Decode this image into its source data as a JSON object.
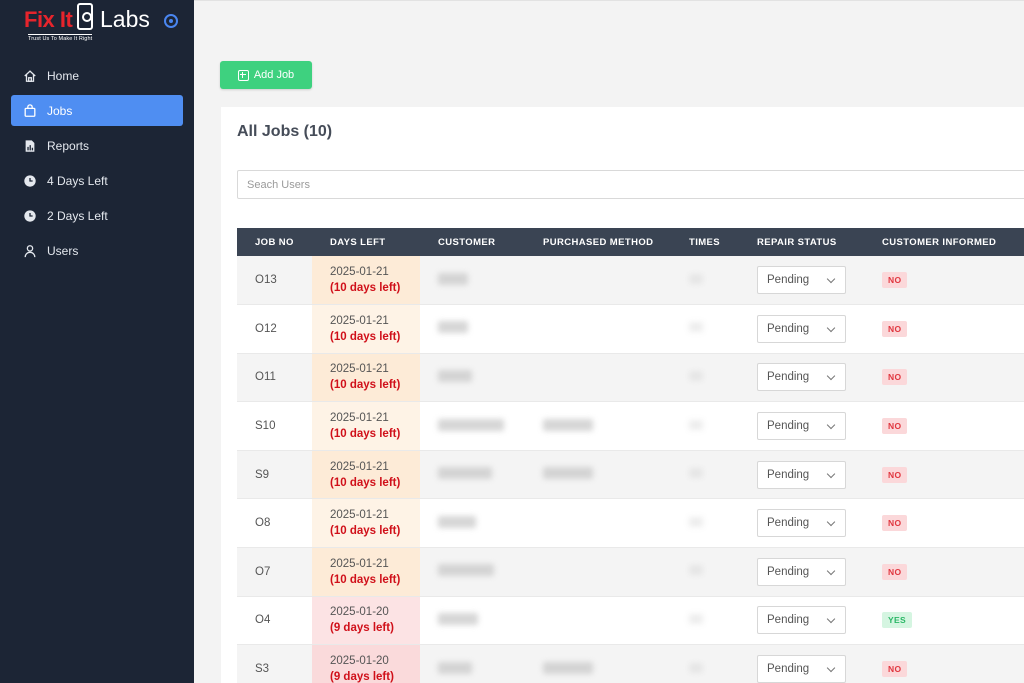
{
  "brand": {
    "name_left": "Fix It",
    "name_right": "Labs",
    "tagline": "Trust Us To Make It Right"
  },
  "sidebar": {
    "items": [
      {
        "label": "Home",
        "icon": "home-icon",
        "active": false
      },
      {
        "label": "Jobs",
        "icon": "bag-icon",
        "active": true
      },
      {
        "label": "Reports",
        "icon": "report-icon",
        "active": false
      },
      {
        "label": "4 Days Left",
        "icon": "clock-icon",
        "active": false
      },
      {
        "label": "2 Days Left",
        "icon": "clock-icon",
        "active": false
      },
      {
        "label": "Users",
        "icon": "user-icon",
        "active": false
      }
    ]
  },
  "toolbar": {
    "add_job_label": "Add Job"
  },
  "panel": {
    "title": "All Jobs (10)",
    "search_placeholder": "Seach Users"
  },
  "table": {
    "columns": [
      "JOB NO",
      "DAYS LEFT",
      "CUSTOMER",
      "PURCHASED METHOD",
      "TIMES",
      "REPAIR STATUS",
      "CUSTOMER INFORMED"
    ],
    "rows": [
      {
        "job_no": "O13",
        "date": "2025-01-21",
        "days_left": "(10 days left)",
        "status": "Pending",
        "informed": "NO"
      },
      {
        "job_no": "O12",
        "date": "2025-01-21",
        "days_left": "(10 days left)",
        "status": "Pending",
        "informed": "NO"
      },
      {
        "job_no": "O11",
        "date": "2025-01-21",
        "days_left": "(10 days left)",
        "status": "Pending",
        "informed": "NO"
      },
      {
        "job_no": "S10",
        "date": "2025-01-21",
        "days_left": "(10 days left)",
        "status": "Pending",
        "informed": "NO"
      },
      {
        "job_no": "S9",
        "date": "2025-01-21",
        "days_left": "(10 days left)",
        "status": "Pending",
        "informed": "NO"
      },
      {
        "job_no": "O8",
        "date": "2025-01-21",
        "days_left": "(10 days left)",
        "status": "Pending",
        "informed": "NO"
      },
      {
        "job_no": "O7",
        "date": "2025-01-21",
        "days_left": "(10 days left)",
        "status": "Pending",
        "informed": "NO"
      },
      {
        "job_no": "O4",
        "date": "2025-01-20",
        "days_left": "(9 days left)",
        "status": "Pending",
        "informed": "YES"
      },
      {
        "job_no": "S3",
        "date": "2025-01-20",
        "days_left": "(9 days left)",
        "status": "Pending",
        "informed": "NO"
      }
    ]
  },
  "colors": {
    "sidebar_bg": "#1c2535",
    "active_nav": "#4f8ef2",
    "add_button": "#3ed17f",
    "table_header": "#3a4453",
    "days_left_text": "#d0101a"
  }
}
